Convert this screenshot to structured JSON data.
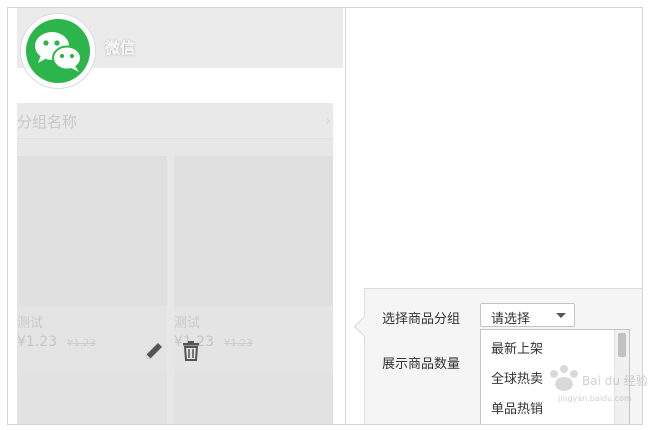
{
  "shop": {
    "name": "微信"
  },
  "group": {
    "title": "分组名称",
    "chevron": "›"
  },
  "products": [
    {
      "name": "测试",
      "price": "¥1.23",
      "original_price": "¥1.23"
    },
    {
      "name": "测试",
      "price": "¥1.23",
      "original_price": "¥1.23"
    }
  ],
  "icons": {
    "edit": "pencil-icon",
    "delete": "trash-icon",
    "logo": "wechat-icon"
  },
  "popover": {
    "group_label": "选择商品分组",
    "count_label": "展示商品数量",
    "select_value": "请选择",
    "options": [
      "最新上架",
      "全球热卖",
      "单品热销"
    ]
  },
  "watermark": {
    "text": "Bai du 经验",
    "sub": "jingyan.baidu.com"
  },
  "colors": {
    "wechat_green": "#2cb54a",
    "panel_gray": "#e7e7e7"
  }
}
